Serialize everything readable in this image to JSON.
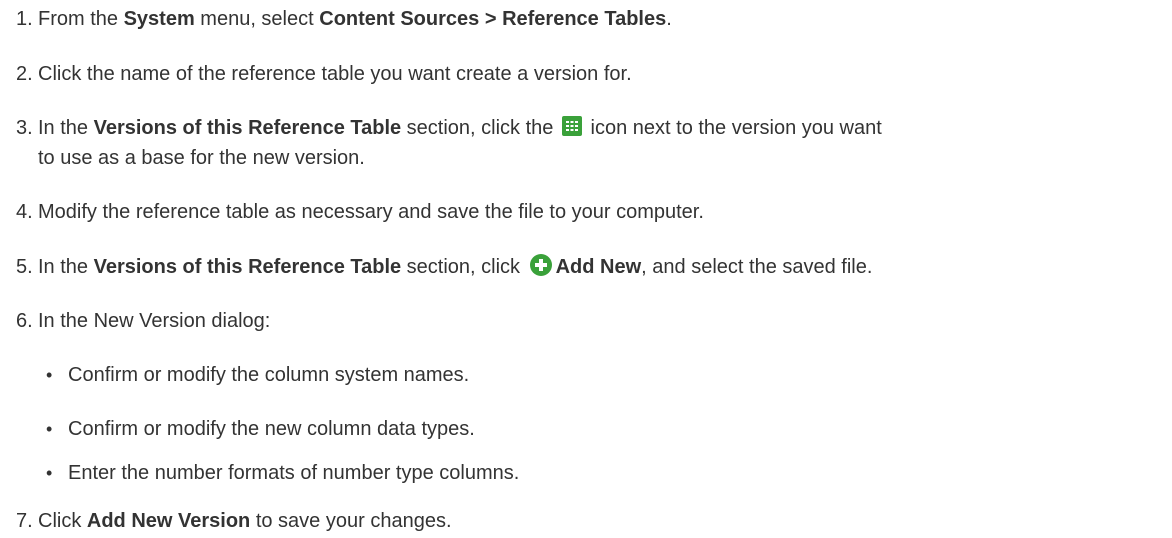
{
  "steps": [
    {
      "num": "1.",
      "pre": "From the ",
      "b1": "System",
      "mid": " menu, select ",
      "b2": "Content Sources > Reference Tables",
      "post": "."
    },
    {
      "num": "2.",
      "text": "Click the name of the reference table you want create a version for."
    },
    {
      "num": "3.",
      "pre": "In the ",
      "b1": "Versions of this Reference Table",
      "mid": " section, click the ",
      "icon": "grid-icon",
      "post": " icon next to the version you want",
      "line2": "to use as a base for the new version."
    },
    {
      "num": "4.",
      "text": "Modify the reference table as necessary and save the file to your computer."
    },
    {
      "num": "5.",
      "pre": "In the ",
      "b1": "Versions of this Reference Table",
      "mid": " section, click ",
      "icon": "plus-circle-icon",
      "b2": "Add New",
      "post": ", and select the saved file."
    },
    {
      "num": "6.",
      "text": "In the New Version dialog:"
    },
    {
      "num": "7.",
      "pre": "Click ",
      "b1": "Add New Version",
      "post": " to save your changes."
    }
  ],
  "bullets": [
    "Confirm or modify the column system names.",
    "Confirm or modify the new column data types.",
    "Enter the number formats of number type columns."
  ],
  "bullet_char": "•",
  "colors": {
    "text": "#333333",
    "icon_green": "#3aa13a"
  }
}
